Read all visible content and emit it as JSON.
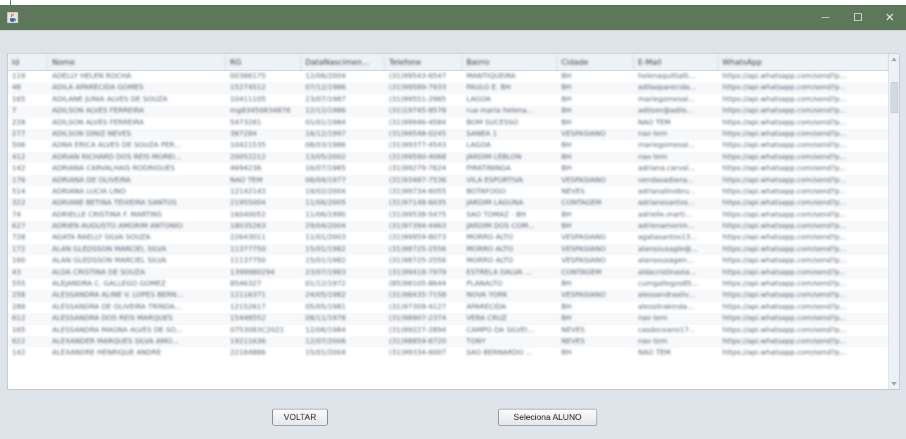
{
  "window": {
    "icon": "java-cup-icon",
    "controls": {
      "minimize": "minimize-icon",
      "maximize": "maximize-icon",
      "close": "✕"
    }
  },
  "table": {
    "columns": [
      "Id",
      "Nome",
      "RG",
      "DataNascimen...",
      "Telefone",
      "Bairro",
      "Cidade",
      "E-Mail",
      "WhatsApp"
    ],
    "rows": [
      [
        "119",
        "ADELLY HELEN ROCHA",
        "00386175",
        "12/06/2004",
        "(31)99543-6547",
        "MANTIQUEIRA",
        "BH",
        "helenaquittalli...",
        "https://api.whatsapp.com/send?p..."
      ],
      [
        "46",
        "ADILA APARECIDA GOMES",
        "15274512",
        "07/12/1986",
        "(31)99589-7933",
        "PAULO E. BH",
        "BH",
        "adilaaparecida...",
        "https://api.whatsapp.com/send?p..."
      ],
      [
        "165",
        "ADILANE JUNIA ALVES DE SOUZA",
        "10411105",
        "23/07/1987",
        "(31)99551-2985",
        "LAGOA",
        "BH",
        "mariegomesal...",
        "https://api.whatsapp.com/send?p..."
      ],
      [
        "7",
        "ADILSON ALVES FERREIRA",
        "mg83450834876",
        "12/12/1986",
        "(31)19745-8578",
        "rua maria helena...",
        "BH",
        "adilson@adils...",
        "https://api.whatsapp.com/send?p..."
      ],
      [
        "228",
        "ADILSON ALVES FERREIRA",
        "5473281",
        "01/01/1984",
        "(31)99946-4584",
        "BOM SUCESSO",
        "BH",
        "NAO TEM",
        "https://api.whatsapp.com/send?p..."
      ],
      [
        "277",
        "ADILSON DINIZ NEVES",
        "387284",
        "16/12/1997",
        "(31)99548-0245",
        "SANEA 1",
        "VESPASIANO",
        "nao tem",
        "https://api.whatsapp.com/send?p..."
      ],
      [
        "506",
        "ADNA ERICA ALVES DE SOUZA PER...",
        "10421535",
        "08/03/1986",
        "(31)99377-4543",
        "LAGOA",
        "BH",
        "mariegomesal...",
        "https://api.whatsapp.com/send?p..."
      ],
      [
        "412",
        "ADRIAN RICHARD DOS REIS MOREI...",
        "20052212",
        "13/05/2002",
        "(31)99590-4068",
        "JARDIM LEBLON",
        "BH",
        "nao tem",
        "https://api.whatsapp.com/send?p..."
      ],
      [
        "142",
        "ADRIANA CARVALHAIS RODRIGUES",
        "4694236",
        "16/07/1985",
        "(31)99279-7624",
        "PIRATININGA",
        "BH",
        "adriana.carval...",
        "https://api.whatsapp.com/send?p..."
      ],
      [
        "176",
        "ADRIANA DE OLIVEIRA",
        "NAO TEM",
        "06/04/1977",
        "(31)93487-7536",
        "VILA ESPORTIVA",
        "VESPASIANO",
        "vendasadiana...",
        "https://api.whatsapp.com/send?p..."
      ],
      [
        "514",
        "ADRIANA LUCIA LINO",
        "12142143",
        "19/02/2004",
        "(31)99734-6055",
        "BOTAFOGO",
        "NEVES",
        "adrianalinobru...",
        "https://api.whatsapp.com/send?p..."
      ],
      [
        "322",
        "ADRIANE BETINA TEIXEIRA SANTOS",
        "21955004",
        "11/06/2005",
        "(31)97148-6035",
        "JARDIM LAGUNA",
        "CONTAGEM",
        "adrianesantos...",
        "https://api.whatsapp.com/send?p..."
      ],
      [
        "74",
        "ADRIELLE CRISTINA F. MARTINS",
        "16040052",
        "11/06/1990",
        "(31)99538-5475",
        "SAO TOMAZ - BH",
        "BH",
        "adrielle.marti...",
        "https://api.whatsapp.com/send?p..."
      ],
      [
        "627",
        "ADRIEN AUGUSTO AMORIM ANTONIO",
        "18035263",
        "29/04/2004",
        "(31)97394-4463",
        "JARDIM DOS COM...",
        "BH",
        "adrienamorim...",
        "https://api.whatsapp.com/send?p..."
      ],
      [
        "728",
        "AGATA RAELLY SILVA SOUZA",
        "22643011",
        "11/01/2003",
        "(31)99959-8073",
        "MORRO ALTO",
        "VESPASIANO",
        "agatasantos13...",
        "https://api.whatsapp.com/send?p..."
      ],
      [
        "172",
        "ALAN GLEDSSON MARCIEL SILVA",
        "11377750",
        "15/01/1982",
        "(31)98725-2556",
        "MORRO ALTO",
        "VESPASIANO",
        "alansousagle@...",
        "https://api.whatsapp.com/send?p..."
      ],
      [
        "160",
        "ALAN GLEDSSON MARCIEL SILVA",
        "11137750",
        "15/01/1982",
        "(31)98725-2556",
        "MORRO ALTO",
        "VESPASIANO",
        "alansousagen...",
        "https://api.whatsapp.com/send?p..."
      ],
      [
        "43",
        "ALDA CRISTINA DE SOUZA",
        "1399980294",
        "23/07/1983",
        "(31)99418-7979",
        "ESTRELA DALVA ...",
        "CONTAGEM",
        "aldacristinasta...",
        "https://api.whatsapp.com/send?p..."
      ],
      [
        "555",
        "ALEJANDRA C. GALLEGO GOMEZ",
        "8546327",
        "01/12/1972",
        "(85)98105-8644",
        "PLANALTO",
        "BH",
        "cumgallegos85...",
        "https://api.whatsapp.com/send?p..."
      ],
      [
        "258",
        "ALESSANDRA ALINE V. LOPES BERN...",
        "12116371",
        "24/05/1982",
        "(31)98435-7158",
        "NOVA YORK",
        "VESPASIANO",
        "alessandraaliv...",
        "https://api.whatsapp.com/send?p..."
      ],
      [
        "286",
        "ALESSANDRA DE OLIVEIRA TRINDA...",
        "12152617",
        "05/05/1981",
        "(31)97309-4127",
        "APARECIDA",
        "BH",
        "alessitrakinda...",
        "https://api.whatsapp.com/send?p..."
      ],
      [
        "612",
        "ALESSANDRA DOS REIS MARQUES",
        "15448552",
        "08/11/1978",
        "(31)98907-2374",
        "VERA CRUZ",
        "BH",
        "nao tem",
        "https://api.whatsapp.com/send?p..."
      ],
      [
        "165",
        "ALESSANDRA MAGNA ALVES DE SO...",
        "0753083C2021",
        "12/06/1984",
        "(31)99227-2894",
        "CAMPO DA SILVEI...",
        "NEVES",
        "casdoceano17...",
        "https://api.whatsapp.com/send?p..."
      ],
      [
        "622",
        "ALEXANDER MARQUES SILVA AMO...",
        "19211636",
        "12/07/2006",
        "(31)98859-8720",
        "TONY",
        "NEVES",
        "nao tem",
        "https://api.whatsapp.com/send?p..."
      ],
      [
        "142",
        "ALEXANDRE HENRIQUE ANDRE",
        "22164886",
        "15/01/2004",
        "(31)99334-6007",
        "SAO BERNARDO ...",
        "BH",
        "NAO TEM",
        "https://api.whatsapp.com/send?p..."
      ]
    ]
  },
  "buttons": {
    "voltar": "VOLTAR",
    "seleciona": "Seleciona ALUNO"
  }
}
